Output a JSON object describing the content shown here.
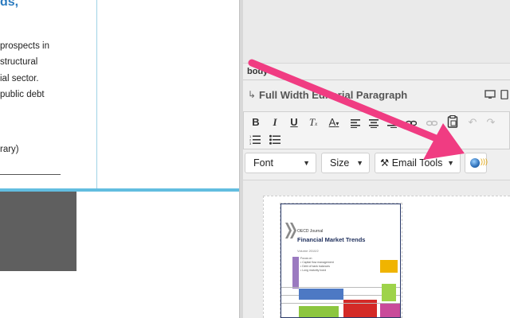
{
  "left_preview": {
    "title_fragment": "ds,",
    "lines": [
      "prospects in",
      "structural",
      "ial sector.",
      "public debt",
      "rary)"
    ]
  },
  "right_panel": {
    "body_label": "body",
    "section_title": "Full Width Editorial Paragraph",
    "toolbar_icons": [
      "bold-icon",
      "italic-icon",
      "underline-icon",
      "clear-format-icon",
      "font-color-icon",
      "align-left-icon",
      "align-center-icon",
      "align-right-icon",
      "align-justify-icon",
      "link-icon",
      "unlink-icon",
      "paste-icon",
      "undo-icon",
      "redo-icon",
      "numbered-list-icon",
      "bulleted-list-icon"
    ],
    "font_dropdown": "Font",
    "size_dropdown": "Size",
    "email_tools": "Email Tools",
    "email_tools_icon": "tools-icon",
    "globe_icon": "globe-link-icon"
  },
  "cover": {
    "kicker": "OECD Journal",
    "title": "Financial Market Trends",
    "volume": "Volume 2010/2",
    "focus": [
      "Focus on",
      "• Capital flow management",
      "• Debt of bank balances",
      "• Long maturity bond"
    ]
  },
  "colors": {
    "accent_blue": "#62bde0",
    "arrow_pink": "#f03c82",
    "title_blue": "#2b7bbf"
  }
}
